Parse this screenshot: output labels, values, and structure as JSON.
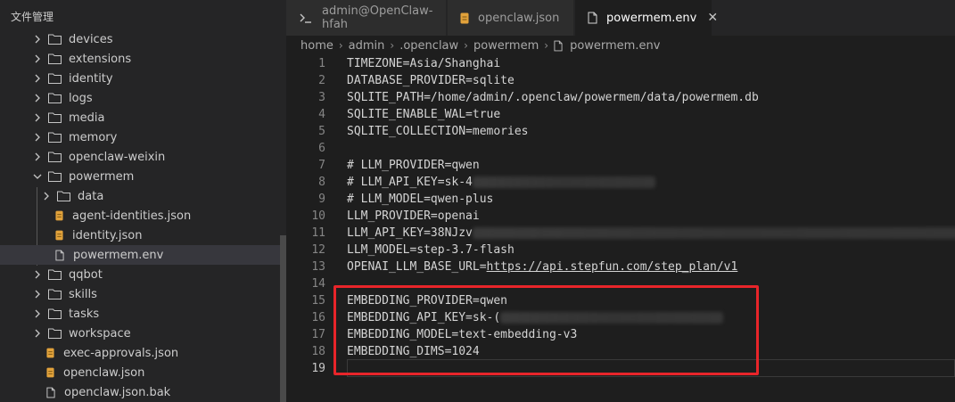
{
  "sidebar": {
    "title": "文件管理",
    "items": [
      {
        "label": "devices",
        "type": "folder",
        "expanded": false
      },
      {
        "label": "extensions",
        "type": "folder",
        "expanded": false
      },
      {
        "label": "identity",
        "type": "folder",
        "expanded": false
      },
      {
        "label": "logs",
        "type": "folder",
        "expanded": false
      },
      {
        "label": "media",
        "type": "folder",
        "expanded": false
      },
      {
        "label": "memory",
        "type": "folder",
        "expanded": false
      },
      {
        "label": "openclaw-weixin",
        "type": "folder",
        "expanded": false
      },
      {
        "label": "powermem",
        "type": "folder",
        "expanded": true
      },
      {
        "label": "data",
        "type": "folder",
        "expanded": false
      },
      {
        "label": "agent-identities.json",
        "type": "json"
      },
      {
        "label": "identity.json",
        "type": "json"
      },
      {
        "label": "powermem.env",
        "type": "file",
        "selected": true
      },
      {
        "label": "qqbot",
        "type": "folder",
        "expanded": false
      },
      {
        "label": "skills",
        "type": "folder",
        "expanded": false
      },
      {
        "label": "tasks",
        "type": "folder",
        "expanded": false
      },
      {
        "label": "workspace",
        "type": "folder",
        "expanded": false
      },
      {
        "label": "exec-approvals.json",
        "type": "json"
      },
      {
        "label": "openclaw.json",
        "type": "json"
      },
      {
        "label": "openclaw.json.bak",
        "type": "file"
      }
    ]
  },
  "tabs": [
    {
      "label": "admin@OpenClaw-hfah",
      "icon": "terminal-icon"
    },
    {
      "label": "openclaw.json",
      "icon": "json-icon"
    },
    {
      "label": "powermem.env",
      "icon": "file-icon",
      "active": true,
      "close": "✕"
    }
  ],
  "breadcrumb": [
    "home",
    "admin",
    ".openclaw",
    "powermem",
    "powermem.env"
  ],
  "editor": {
    "lines": [
      {
        "n": "1",
        "text": "TIMEZONE=Asia/Shanghai"
      },
      {
        "n": "2",
        "text": "DATABASE_PROVIDER=sqlite"
      },
      {
        "n": "3",
        "text": "SQLITE_PATH=/home/admin/.openclaw/powermem/data/powermem.db"
      },
      {
        "n": "4",
        "text": "SQLITE_ENABLE_WAL=true"
      },
      {
        "n": "5",
        "text": "SQLITE_COLLECTION=memories"
      },
      {
        "n": "6",
        "text": ""
      },
      {
        "n": "7",
        "text": "# LLM_PROVIDER=qwen"
      },
      {
        "n": "8",
        "text": "# LLM_API_KEY=sk-4"
      },
      {
        "n": "9",
        "text": "# LLM_MODEL=qwen-plus"
      },
      {
        "n": "10",
        "text": "LLM_PROVIDER=openai"
      },
      {
        "n": "11",
        "text": "LLM_API_KEY=38NJzv"
      },
      {
        "n": "12",
        "text": "LLM_MODEL=step-3.7-flash"
      },
      {
        "n": "13",
        "text": "OPENAI_LLM_BASE_URL=",
        "link": "https://api.stepfun.com/step_plan/v1"
      },
      {
        "n": "14",
        "text": ""
      },
      {
        "n": "15",
        "text": "EMBEDDING_PROVIDER=qwen"
      },
      {
        "n": "16",
        "text": "EMBEDDING_API_KEY=sk-("
      },
      {
        "n": "17",
        "text": "EMBEDDING_MODEL=text-embedding-v3"
      },
      {
        "n": "18",
        "text": "EMBEDDING_DIMS=1024"
      },
      {
        "n": "19",
        "text": ""
      }
    ]
  },
  "colors": {
    "highlight": "#e8252a",
    "json_icon": "#e2a23b"
  }
}
